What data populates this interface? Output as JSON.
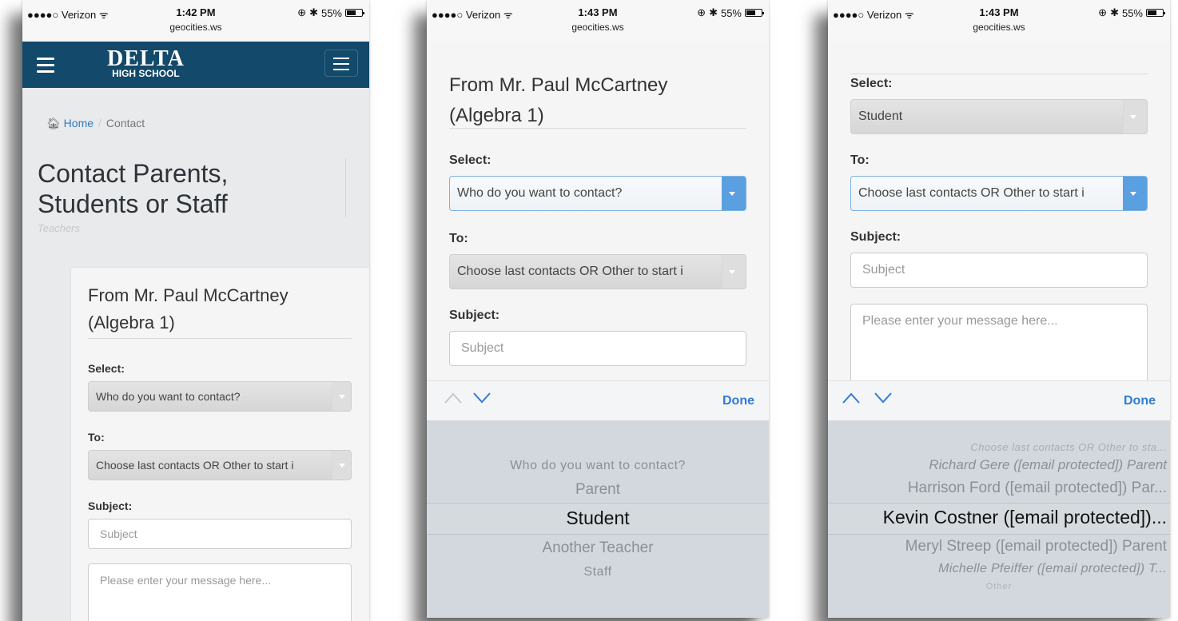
{
  "status_bar": {
    "carrier": "●●●●○ Verizon",
    "battery": "55%",
    "url": "geocities.ws",
    "time_1": "1:42 PM",
    "time_2": "1:43 PM",
    "time_3": "1:43 PM"
  },
  "header": {
    "logo_top": "DELTA",
    "logo_bottom": "HIGH SCHOOL"
  },
  "breadcrumb": {
    "home": "Home",
    "separator": "/",
    "current": "Contact"
  },
  "page": {
    "title": "Contact Parents, Students or Staff",
    "subtitle": "Teachers"
  },
  "form": {
    "from_line1": "From Mr. Paul McCartney",
    "from_line2": "(Algebra 1)",
    "select_label": "Select:",
    "select_value": "Who do you want to contact?",
    "select_value_chosen": "Student",
    "to_label": "To:",
    "to_value": "Choose last contacts OR Other to start i",
    "subject_label": "Subject:",
    "subject_placeholder": "Subject",
    "message_placeholder": "Please enter your message here..."
  },
  "keyboard_accessory": {
    "done_label": "Done"
  },
  "picker_select": {
    "options": [
      "Who do you want to contact?",
      "Parent",
      "Student",
      "Another Teacher",
      "Staff"
    ],
    "selected": "Student"
  },
  "picker_to": {
    "options": [
      "Choose last contacts OR Other to sta...",
      "Richard Gere ([email protected]) Parent",
      "Harrison Ford ([email protected]) Par...",
      "Kevin Costner ([email protected])...",
      "Meryl Streep ([email protected]) Parent",
      "Michelle Pfeiffer ([email protected]) T...",
      "Other"
    ],
    "selected": "Kevin Costner ([email protected])..."
  },
  "colors": {
    "navbar": "#13496a",
    "link": "#337ab7",
    "ios_blue": "#2f7bd8",
    "picker_bg": "#d3d8de"
  }
}
